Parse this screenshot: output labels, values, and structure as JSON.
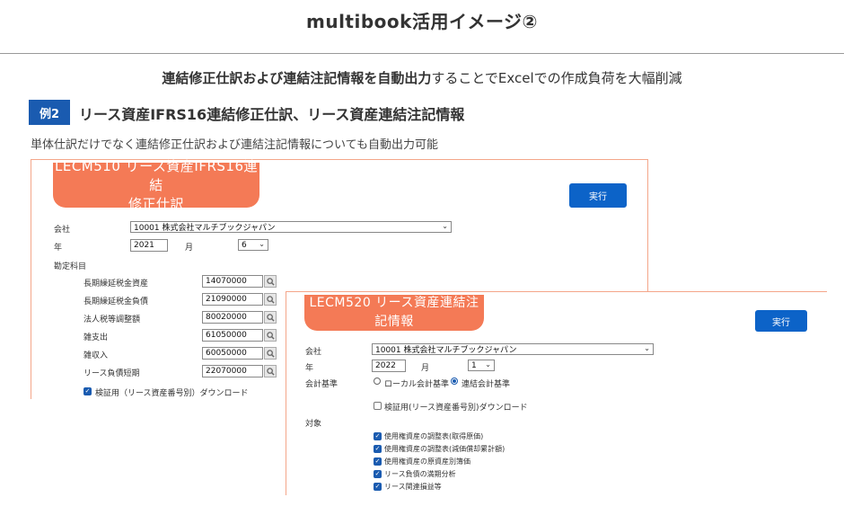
{
  "header": {
    "title": "multibook活用イメージ②",
    "subtitle_bold": "連結修正仕訳および連結注記情報を自動出力",
    "subtitle_rest": "することでExcelでの作成負荷を大幅削減"
  },
  "example": {
    "badge": "例2",
    "title": "リース資産IFRS16連結修正仕訳、リース資産連結注記情報",
    "description": "単体仕訳だけでなく連結修正仕訳および連結注記情報についても自動出力可能"
  },
  "screen1": {
    "banner_line1": "LECM510 リース資産IFRS16連結",
    "banner_line2": "修正仕訳",
    "run_button": "実行",
    "company_label": "会社",
    "company_value": "10001 株式会社マルチブックジャパン",
    "year_label": "年",
    "year_value": "2021",
    "month_label": "月",
    "month_value": "6",
    "accounts_label": "勘定科目",
    "accounts": [
      {
        "label": "長期繰延税金資産",
        "value": "14070000"
      },
      {
        "label": "長期繰延税金負債",
        "value": "21090000"
      },
      {
        "label": "法人税等調整額",
        "value": "80020000"
      },
      {
        "label": "雑支出",
        "value": "61050000"
      },
      {
        "label": "雑収入",
        "value": "60050000"
      },
      {
        "label": "リース負債短期",
        "value": "22070000"
      }
    ],
    "download_label": "検証用（リース資産番号別）ダウンロード",
    "download_checked": true
  },
  "screen2": {
    "banner": "LECM520 リース資産連結注記情報",
    "run_button": "実行",
    "company_label": "会社",
    "company_value": "10001 株式会社マルチブックジャパン",
    "year_label": "年",
    "year_value": "2022",
    "month_label": "月",
    "month_value": "1",
    "basis_label": "会計基準",
    "basis_local": "ローカル会計基準",
    "basis_consolidated": "連結会計基準",
    "basis_selected": "連結会計基準",
    "download_label": "検証用(リース資産番号別)ダウンロード",
    "download_checked": false,
    "target_label": "対象",
    "targets": [
      {
        "label": "使用権資産の調整表(取得原価)",
        "checked": true
      },
      {
        "label": "使用権資産の調整表(減価償却累計額)",
        "checked": true
      },
      {
        "label": "使用権資産の原資産別簿価",
        "checked": true
      },
      {
        "label": "リース負債の満期分析",
        "checked": true
      },
      {
        "label": "リース関連損益等",
        "checked": true
      }
    ]
  },
  "colors": {
    "accent_orange": "#f47a56",
    "button_blue": "#0c63c8",
    "badge_blue": "#1a5bb0"
  }
}
